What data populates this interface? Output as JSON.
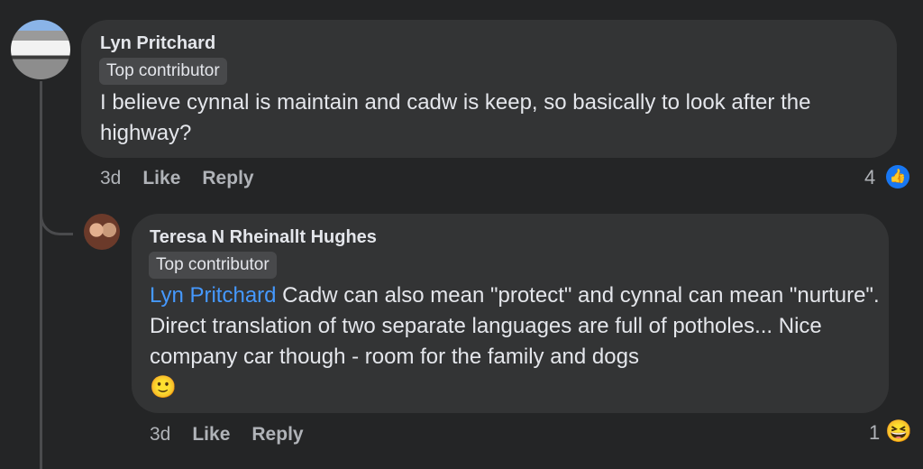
{
  "comments": [
    {
      "author": "Lyn Pritchard",
      "badge": "Top contributor",
      "text": "I believe cynnal is maintain and cadw is keep, so basically to look after the highway?",
      "time": "3d",
      "like": "Like",
      "reply": "Reply",
      "reaction_count": "4",
      "reaction": "like-icon"
    },
    {
      "author": "Teresa N Rheinallt Hughes",
      "badge": "Top contributor",
      "mention": "Lyn Pritchard",
      "text": " Cadw can also mean \"protect\" and cynnal can mean \"nurture\". Direct translation of two separate languages are full of potholes...  Nice company car though - room for the family and dogs",
      "emoji": "🙂",
      "time": "3d",
      "like": "Like",
      "reply": "Reply",
      "reaction_count": "1",
      "reaction": "laughing-face-icon"
    }
  ],
  "colors": {
    "background": "#242526",
    "bubble": "#333435",
    "mention": "#4599ff",
    "like": "#1877f2"
  }
}
